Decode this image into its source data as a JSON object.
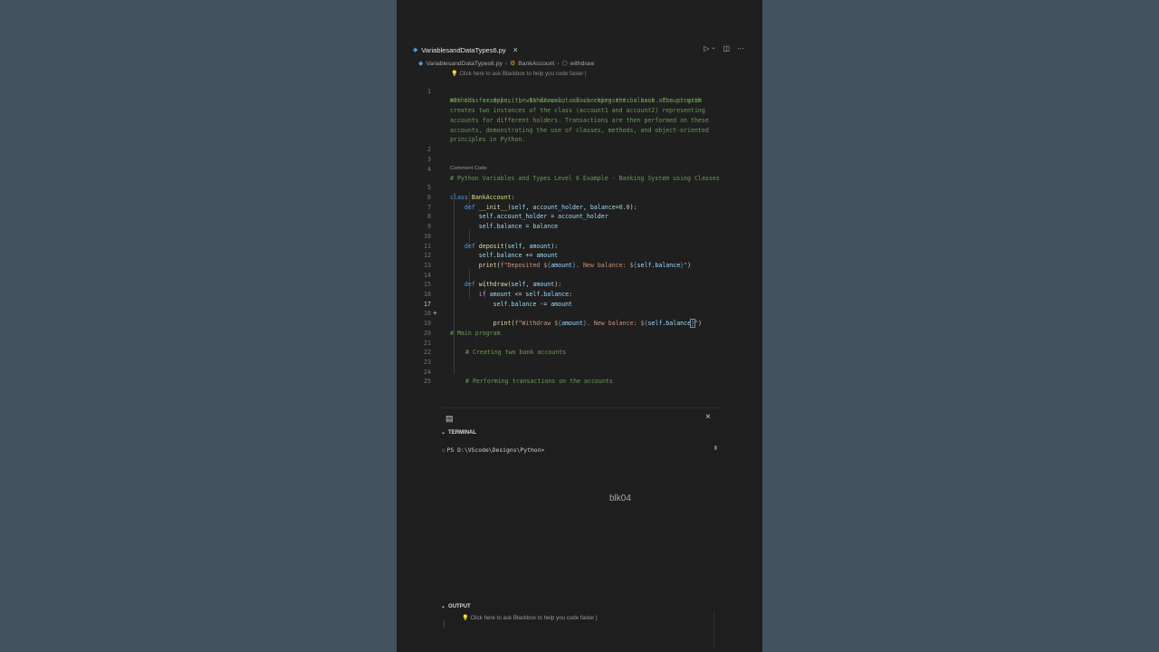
{
  "tab": {
    "filename": "VariablesandDataTypes6.py",
    "close": "×"
  },
  "breadcrumb": {
    "file": "VariablesandDataTypes6.py",
    "class": "BankAccount",
    "method": "withdraw"
  },
  "hint_top": "Click here to ask Blackbox to help you code faster |",
  "code_lens": "Comment Code",
  "terminal": {
    "header": "TERMINAL",
    "prompt": "PS D:\\VScode\\Designs\\Python>",
    "close": "×"
  },
  "watermark": "blk04",
  "output": {
    "header": "OUTPUT",
    "hint": "Click here to ask Blackbox to help you code faster |"
  },
  "line_numbers": [
    "1",
    "2",
    "3",
    "4",
    "5",
    "6",
    "7",
    "8",
    "9",
    "10",
    "11",
    "12",
    "13",
    "14",
    "15",
    "16",
    "17",
    "18",
    "19",
    "20",
    "21",
    "22",
    "23",
    "24",
    "25"
  ],
  "comment_block": [
    "#In this example, the BankAccount class represents a bank account with",
    "methods for deposit, withdrawal, and checking the balance. The program",
    "creates two instances of the class (account1 and account2) representing",
    "accounts for different holders. Transactions are then performed on these",
    "accounts, demonstrating the use of classes, methods, and object-oriented",
    "principles in Python."
  ],
  "code": {
    "l4": "# Python Variables and Types Level 6 Example - Banking System using Classes",
    "l5_kw": "class",
    "l5_name": "BankAccount",
    "l6_kw": "def",
    "l6_fn": "__init__",
    "l6_self": "self",
    "l6_p1": "account_holder",
    "l6_p2": "balance",
    "l6_num": "0.0",
    "l7_a": "self",
    "l7_b": "account_holder",
    "l7_c": "account_holder",
    "l8_a": "self",
    "l8_b": "balance",
    "l8_c": "balance",
    "l10_kw": "def",
    "l10_fn": "deposit",
    "l10_self": "self",
    "l10_p1": "amount",
    "l11_a": "self",
    "l11_b": "balance",
    "l11_c": "amount",
    "l12_fn": "print",
    "l12_str1": "f\"Deposited $",
    "l12_v1": "amount",
    "l12_str2": ". New balance: $",
    "l12_v2": "self.balance",
    "l12_str3": "\"",
    "l14_kw": "def",
    "l14_fn": "withdraw",
    "l14_self": "self",
    "l14_p1": "amount",
    "l15_kw": "if",
    "l15_a": "amount",
    "l15_b": "self",
    "l15_c": "balance",
    "l16_a": "self",
    "l16_b": "balance",
    "l16_c": "amount",
    "l17_fn": "print",
    "l17_str1": "f\"Withdraw $",
    "l17_v1": "amount",
    "l17_str2": ". New balance: $",
    "l17_v2": "self.balance",
    "l17_str3": "\"",
    "l19": "# Main program",
    "l21": "# Creating two bank accounts",
    "l24": "# Performing transactions on the accounts"
  }
}
